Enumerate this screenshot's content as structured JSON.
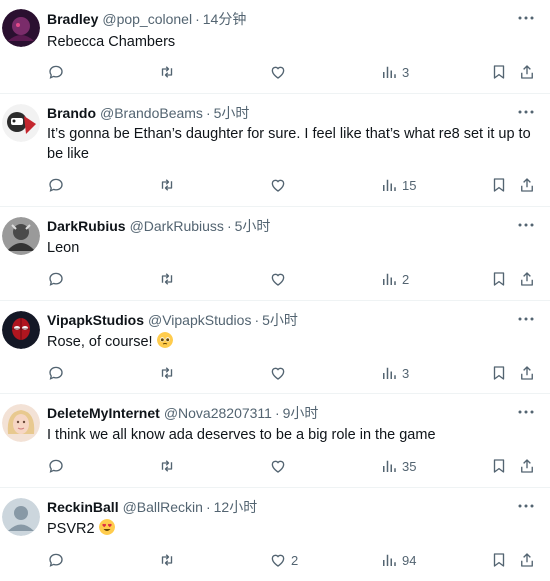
{
  "tweets": [
    {
      "name": "Bradley",
      "handle": "@pop_colonel",
      "time": "14分钟",
      "text": "Rebecca Chambers",
      "replies": "",
      "retweets": "",
      "likes": "",
      "views": "3",
      "avatar_icon": "avatar-dark-purple"
    },
    {
      "name": "Brando",
      "handle": "@BrandoBeams",
      "time": "5小时",
      "text": "It’s gonna be Ethan’s daughter for sure. I feel like that’s what re8 set it up to be like",
      "replies": "",
      "retweets": "",
      "likes": "",
      "views": "15",
      "avatar_icon": "avatar-cartoon-red"
    },
    {
      "name": "DarkRubius",
      "handle": "@DarkRubiuss",
      "time": "5小时",
      "text": "Leon",
      "replies": "",
      "retweets": "",
      "likes": "",
      "views": "2",
      "avatar_icon": "avatar-gray-photo"
    },
    {
      "name": "VipapkStudios",
      "handle": "@VipapkStudios",
      "time": "5小时",
      "text": "Rose, of course!",
      "replies": "",
      "retweets": "",
      "likes": "",
      "views": "3",
      "avatar_icon": "avatar-spiderman",
      "emoji": "pleading-face-emoji"
    },
    {
      "name": "DeleteMyInternet",
      "handle": "@Nova28207311",
      "time": "9小时",
      "text": "I think we all know ada deserves to be a big role in the game",
      "replies": "",
      "retweets": "",
      "likes": "",
      "views": "35",
      "avatar_icon": "avatar-blonde-person"
    },
    {
      "name": "ReckinBall",
      "handle": "@BallReckin",
      "time": "12小时",
      "text": "PSVR2",
      "replies": "",
      "retweets": "",
      "likes": "2",
      "views": "94",
      "avatar_icon": "avatar-default-silhouette",
      "emoji": "heart-eyes-emoji"
    }
  ],
  "colors": {
    "text": "#0f1419",
    "muted": "#536471",
    "border": "#eff3f4",
    "default_avatar": "#ccd6dd"
  }
}
